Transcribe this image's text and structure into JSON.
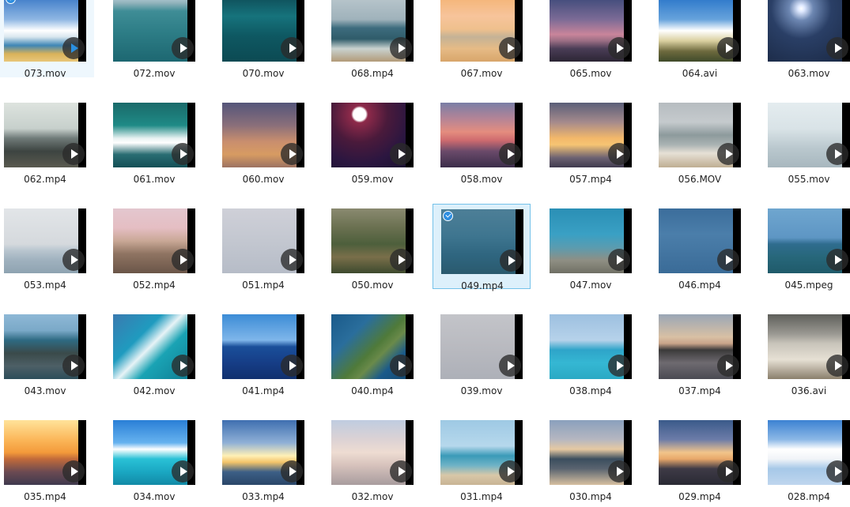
{
  "files": [
    {
      "name": "073.mov",
      "state": "focused",
      "bg": "linear-gradient(180deg,#3d7bc8 0%,#8fb7e3 35%,#ffffff 52%,#d8e6ee 62%,#3e86b6 75%,#d9b25a 88%,#e8c67a 100%)"
    },
    {
      "name": "072.mov",
      "bg": "linear-gradient(180deg,#b7cdd6 0%,#8fb1ba 10%,#3f8d96 22%,#2d7d86 55%,#1d6771 100%)"
    },
    {
      "name": "070.mov",
      "bg": "linear-gradient(180deg,#0f4f5a 0%,#16737c 30%,#0e5862 60%,#0c4a53 100%)"
    },
    {
      "name": "068.mp4",
      "bg": "linear-gradient(180deg,#b9c6cc 0%,#9fb2bb 35%,#3d6c7e 48%,#2f5c6a 65%,#c9d2d0 80%,#b29a78 100%)"
    },
    {
      "name": "067.mov",
      "bg": "linear-gradient(180deg,#f4b476 0%,#f7c49b 30%,#efc08d 50%,#c4b296 62%,#e6bb86 80%,#d8a56a 100%)"
    },
    {
      "name": "065.mov",
      "bg": "linear-gradient(180deg,#3e4a7a 0%,#7c6b96 35%,#c9849a 58%,#9a6e84 68%,#4a3d56 80%,#2c2534 100%)"
    },
    {
      "name": "064.avi",
      "bg": "linear-gradient(180deg,#2a76c9 0%,#67a3dc 35%,#ffffff 52%,#d9cf9f 68%,#6e6a3e 84%,#3f4a2a 100%)"
    },
    {
      "name": "063.mov",
      "bg": "radial-gradient(circle at 45% 18%,#ffffff 0,#dfe9ff 5%,#6d87b2 18%,#2a3f66 45%,#1b2a46 100%)"
    },
    {
      "name": "062.mp4",
      "bg": "linear-gradient(180deg,#dde3de 0%,#c7d0cc 40%,#6f7a78 55%,#3d4441 75%,#5a5a4f 100%)"
    },
    {
      "name": "061.mov",
      "bg": "linear-gradient(180deg,#1a6a6a 0%,#1f8a86 35%,#e8f2f2 55%,#ffffff 62%,#2a6d73 80%,#124f56 100%)"
    },
    {
      "name": "060.mov",
      "bg": "linear-gradient(180deg,#54557a 0%,#8a6f7a 35%,#c98e6e 60%,#d79b62 80%,#9c7262 100%)"
    },
    {
      "name": "059.mov",
      "bg": "radial-gradient(circle at 38% 18%,#ffffff 0,#ffffff 9%,#8e2a4a 12%,#4a1a3b 40%,#2b1640 70%,#1a1030 100%)"
    },
    {
      "name": "058.mov",
      "bg": "linear-gradient(180deg,#7a7ea6 0%,#b58496 25%,#e48d7f 45%,#cf6b6f 58%,#6a4a6a 75%,#3b2d4a 100%)"
    },
    {
      "name": "057.mp4",
      "bg": "linear-gradient(180deg,#5a5e78 0%,#a58a8c 30%,#f3b86a 55%,#f6c473 65%,#6d6272 85%,#3f3a4e 100%)"
    },
    {
      "name": "056.MOV",
      "bg": "linear-gradient(180deg,#b6bcc0 0%,#c5cacd 30%,#8d9a9c 50%,#aab3b3 65%,#e6e0d6 78%,#bfae92 100%)"
    },
    {
      "name": "055.mov",
      "bg": "linear-gradient(180deg,#e4ecef 0%,#d9e3e7 40%,#bac8ce 70%,#a7b7be 100%)"
    },
    {
      "name": "053.mp4",
      "bg": "linear-gradient(180deg,#e2e5e8 0%,#d5d9dd 55%,#b8c5cf 65%,#9fb1be 80%,#8ea3b1 100%)"
    },
    {
      "name": "052.mp4",
      "bg": "linear-gradient(180deg,#e3c7cf 0%,#e5bec3 30%,#c9a896 50%,#8f7462 70%,#6a5548 100%)"
    },
    {
      "name": "051.mp4",
      "bg": "linear-gradient(180deg,#cfd0d8 0%,#c3c7d0 50%,#b6bcc7 100%)"
    },
    {
      "name": "050.mov",
      "bg": "linear-gradient(180deg,#8a8a70 0%,#6a7050 30%,#4d5f3c 55%,#7a6f4a 75%,#3d4a2e 100%)"
    },
    {
      "name": "049.mp4",
      "state": "selected",
      "bg": "linear-gradient(180deg,#4d7f97 0%,#3f7690 40%,#2f6680 70%,#2a5a6e 100%)"
    },
    {
      "name": "047.mov",
      "bg": "linear-gradient(180deg,#2a8fb5 0%,#3aa0c4 40%,#5a9cb0 60%,#8f8f84 80%,#6f6f64 100%)"
    },
    {
      "name": "046.mp4",
      "bg": "linear-gradient(180deg,#3b6d9b 0%,#4b7eaa 40%,#3a6b97 100%)"
    },
    {
      "name": "045.mpeg",
      "bg": "linear-gradient(180deg,#6fa6cf 0%,#5e96c4 45%,#2f6c8e 55%,#27677a 75%,#1f5a6a 100%)"
    },
    {
      "name": "043.mov",
      "bg": "linear-gradient(180deg,#8fb8d6 0%,#7aa9c8 25%,#2e6a82 40%,#3a4a4a 60%,#4d5f66 80%,#2c4d5a 100%)"
    },
    {
      "name": "042.mov",
      "bg": "linear-gradient(135deg,#3a7ab0 0%,#1f9bbf 35%,#e7f3f6 50%,#1aa3b4 65%,#0f7f95 100%)"
    },
    {
      "name": "041.mp4",
      "bg": "linear-gradient(180deg,#3c8cd6 0%,#7fb6ea 40%,#1a4f9a 50%,#163d86 75%,#10306e 100%)"
    },
    {
      "name": "040.mp4",
      "bg": "linear-gradient(135deg,#1a5a8a 0%,#2a6e9c 30%,#4f7a3a 55%,#6a8a4a 65%,#1a5a8a 80%,#134a74 100%)"
    },
    {
      "name": "039.mov",
      "bg": "linear-gradient(180deg,#c3c4c9 0%,#b9bac0 50%,#adb0b8 100%)"
    },
    {
      "name": "038.mp4",
      "bg": "linear-gradient(180deg,#9dc0e0 0%,#b6d2ea 40%,#2ea4c9 55%,#35b7d3 75%,#2aa9c4 100%)"
    },
    {
      "name": "037.mp4",
      "bg": "linear-gradient(180deg,#9aa6b6 0%,#d8c0a4 35%,#c9a48a 45%,#3b3a3a 55%,#6e6a70 75%,#4a4a52 100%)"
    },
    {
      "name": "036.avi",
      "bg": "linear-gradient(180deg,#5e5f5a 0%,#9a9892 30%,#c8c4ba 45%,#e6e0d4 70%,#8a7f6c 100%)"
    },
    {
      "name": "035.mp4",
      "bg": "linear-gradient(180deg,#ffe39a 0%,#fbb75a 30%,#f39a3a 50%,#c26a3a 60%,#6b4a52 80%,#3f3a4e 100%)"
    },
    {
      "name": "034.mov",
      "bg": "linear-gradient(180deg,#2a7fd6 0%,#66b2ef 35%,#ffffff 45%,#29c1d6 60%,#1aa7c2 80%,#128aa6 100%)"
    },
    {
      "name": "033.mp4",
      "bg": "linear-gradient(180deg,#3f6fb0 0%,#8fb0d6 35%,#fff0b6 55%,#f3c46a 65%,#3c5f86 80%,#2a4668 100%)"
    },
    {
      "name": "032.mov",
      "bg": "linear-gradient(180deg,#bfcce0 0%,#dcd2d4 30%,#eedcd2 50%,#d6c2bc 70%,#a89c9e 100%)"
    },
    {
      "name": "031.mp4",
      "bg": "linear-gradient(180deg,#9ec9e4 0%,#b6d8ec 40%,#3a9ab8 55%,#6fb3c6 70%,#d8c7a8 85%,#c8b494 100%)"
    },
    {
      "name": "030.mp4",
      "bg": "linear-gradient(180deg,#8aa0bd 0%,#b6b7c0 30%,#e6c9a2 45%,#3b4e5e 60%,#5a6470 75%,#d6bfa0 100%)"
    },
    {
      "name": "029.mp4",
      "bg": "linear-gradient(180deg,#3a5a8a 0%,#6c7ca8 30%,#f2c48a 50%,#e8a86a 60%,#3e3a46 75%,#2a2a34 100%)"
    },
    {
      "name": "028.mp4",
      "bg": "linear-gradient(180deg,#3c82d2 0%,#8cb8e6 30%,#ffffff 45%,#f1f4f8 60%,#a6c8e8 75%,#bfd6ee 100%)"
    }
  ]
}
